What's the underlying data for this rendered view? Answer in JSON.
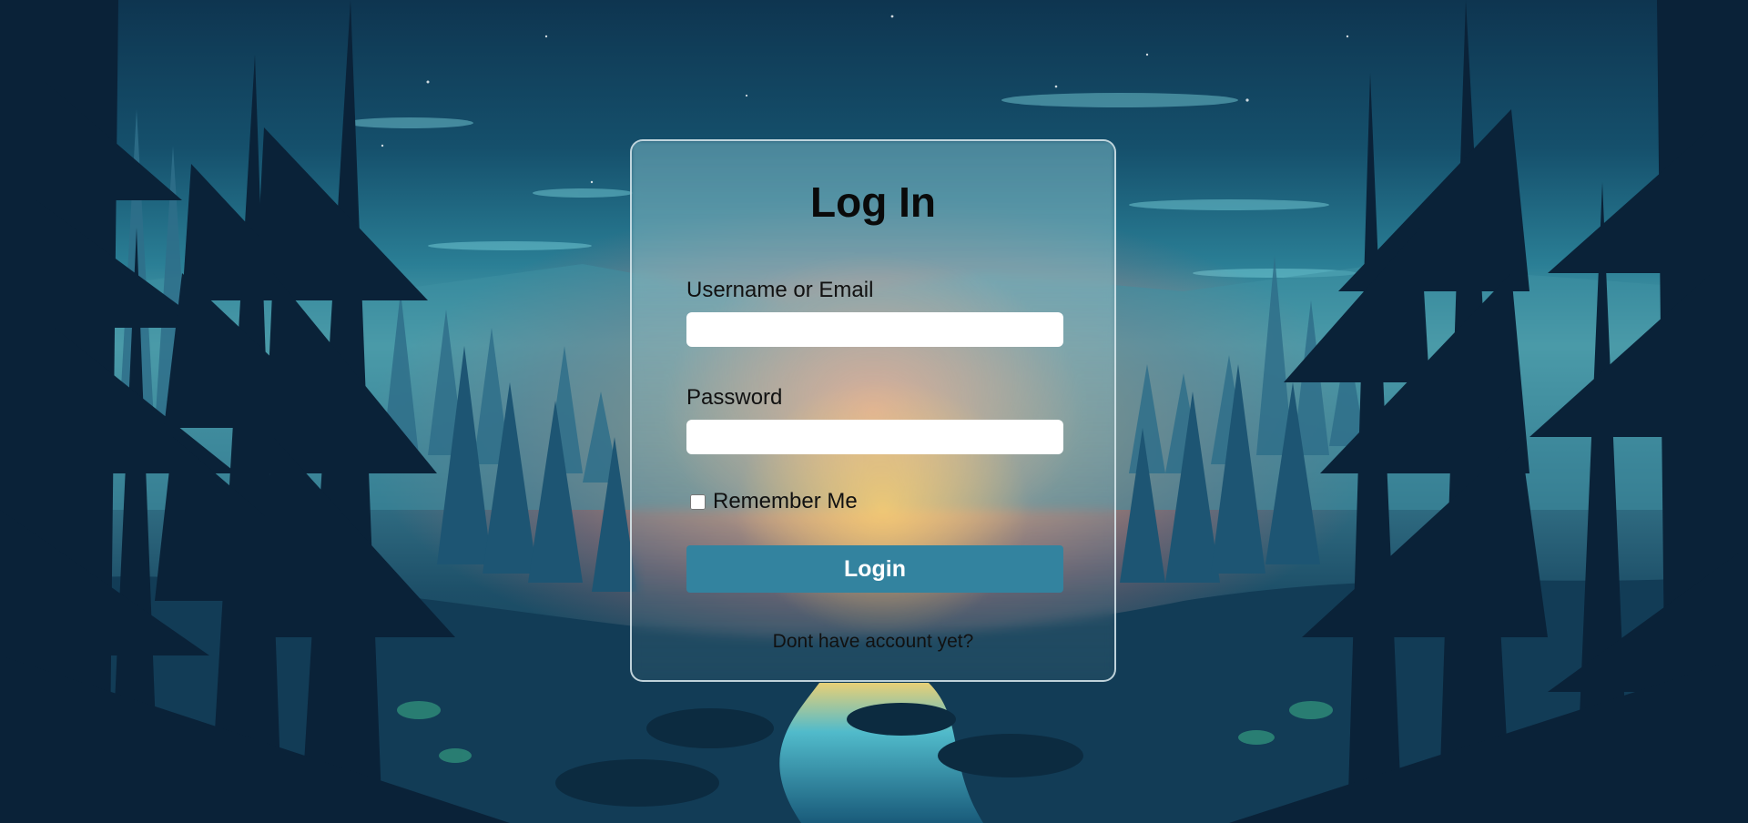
{
  "login": {
    "title": "Log In",
    "username_label": "Username or Email",
    "username_value": "",
    "password_label": "Password",
    "password_value": "",
    "remember_label": "Remember Me",
    "remember_checked": false,
    "submit_label": "Login",
    "signup_link": "Dont have account yet?"
  },
  "colors": {
    "button_bg": "#33839f",
    "card_border": "#dcebf0"
  }
}
